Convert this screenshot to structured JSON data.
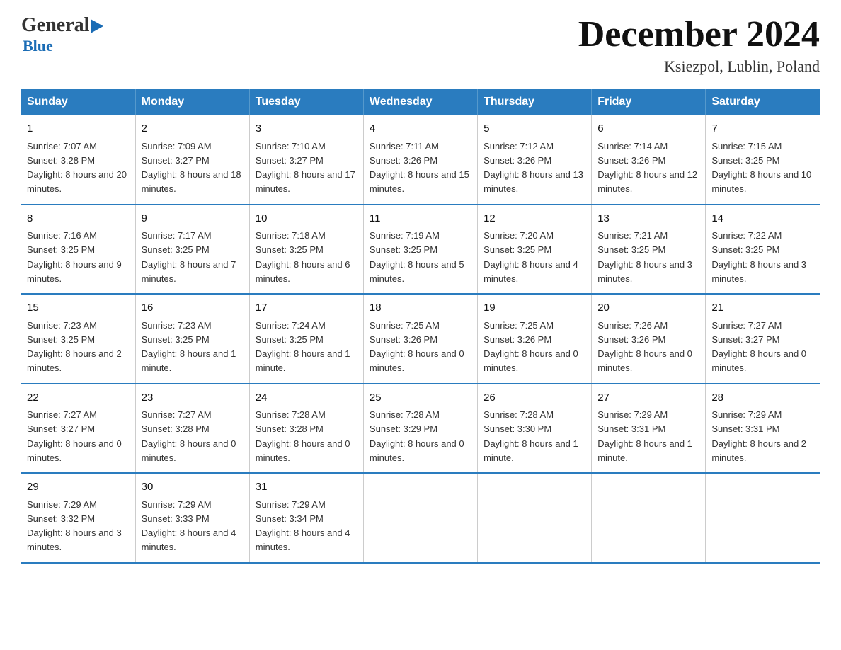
{
  "logo": {
    "general": "General",
    "blue": "Blue",
    "arrow_color": "#1a6cb5"
  },
  "header": {
    "title": "December 2024",
    "subtitle": "Ksiezpol, Lublin, Poland"
  },
  "weekdays": [
    "Sunday",
    "Monday",
    "Tuesday",
    "Wednesday",
    "Thursday",
    "Friday",
    "Saturday"
  ],
  "weeks": [
    [
      {
        "day": "1",
        "sunrise": "7:07 AM",
        "sunset": "3:28 PM",
        "daylight": "8 hours and 20 minutes."
      },
      {
        "day": "2",
        "sunrise": "7:09 AM",
        "sunset": "3:27 PM",
        "daylight": "8 hours and 18 minutes."
      },
      {
        "day": "3",
        "sunrise": "7:10 AM",
        "sunset": "3:27 PM",
        "daylight": "8 hours and 17 minutes."
      },
      {
        "day": "4",
        "sunrise": "7:11 AM",
        "sunset": "3:26 PM",
        "daylight": "8 hours and 15 minutes."
      },
      {
        "day": "5",
        "sunrise": "7:12 AM",
        "sunset": "3:26 PM",
        "daylight": "8 hours and 13 minutes."
      },
      {
        "day": "6",
        "sunrise": "7:14 AM",
        "sunset": "3:26 PM",
        "daylight": "8 hours and 12 minutes."
      },
      {
        "day": "7",
        "sunrise": "7:15 AM",
        "sunset": "3:25 PM",
        "daylight": "8 hours and 10 minutes."
      }
    ],
    [
      {
        "day": "8",
        "sunrise": "7:16 AM",
        "sunset": "3:25 PM",
        "daylight": "8 hours and 9 minutes."
      },
      {
        "day": "9",
        "sunrise": "7:17 AM",
        "sunset": "3:25 PM",
        "daylight": "8 hours and 7 minutes."
      },
      {
        "day": "10",
        "sunrise": "7:18 AM",
        "sunset": "3:25 PM",
        "daylight": "8 hours and 6 minutes."
      },
      {
        "day": "11",
        "sunrise": "7:19 AM",
        "sunset": "3:25 PM",
        "daylight": "8 hours and 5 minutes."
      },
      {
        "day": "12",
        "sunrise": "7:20 AM",
        "sunset": "3:25 PM",
        "daylight": "8 hours and 4 minutes."
      },
      {
        "day": "13",
        "sunrise": "7:21 AM",
        "sunset": "3:25 PM",
        "daylight": "8 hours and 3 minutes."
      },
      {
        "day": "14",
        "sunrise": "7:22 AM",
        "sunset": "3:25 PM",
        "daylight": "8 hours and 3 minutes."
      }
    ],
    [
      {
        "day": "15",
        "sunrise": "7:23 AM",
        "sunset": "3:25 PM",
        "daylight": "8 hours and 2 minutes."
      },
      {
        "day": "16",
        "sunrise": "7:23 AM",
        "sunset": "3:25 PM",
        "daylight": "8 hours and 1 minute."
      },
      {
        "day": "17",
        "sunrise": "7:24 AM",
        "sunset": "3:25 PM",
        "daylight": "8 hours and 1 minute."
      },
      {
        "day": "18",
        "sunrise": "7:25 AM",
        "sunset": "3:26 PM",
        "daylight": "8 hours and 0 minutes."
      },
      {
        "day": "19",
        "sunrise": "7:25 AM",
        "sunset": "3:26 PM",
        "daylight": "8 hours and 0 minutes."
      },
      {
        "day": "20",
        "sunrise": "7:26 AM",
        "sunset": "3:26 PM",
        "daylight": "8 hours and 0 minutes."
      },
      {
        "day": "21",
        "sunrise": "7:27 AM",
        "sunset": "3:27 PM",
        "daylight": "8 hours and 0 minutes."
      }
    ],
    [
      {
        "day": "22",
        "sunrise": "7:27 AM",
        "sunset": "3:27 PM",
        "daylight": "8 hours and 0 minutes."
      },
      {
        "day": "23",
        "sunrise": "7:27 AM",
        "sunset": "3:28 PM",
        "daylight": "8 hours and 0 minutes."
      },
      {
        "day": "24",
        "sunrise": "7:28 AM",
        "sunset": "3:28 PM",
        "daylight": "8 hours and 0 minutes."
      },
      {
        "day": "25",
        "sunrise": "7:28 AM",
        "sunset": "3:29 PM",
        "daylight": "8 hours and 0 minutes."
      },
      {
        "day": "26",
        "sunrise": "7:28 AM",
        "sunset": "3:30 PM",
        "daylight": "8 hours and 1 minute."
      },
      {
        "day": "27",
        "sunrise": "7:29 AM",
        "sunset": "3:31 PM",
        "daylight": "8 hours and 1 minute."
      },
      {
        "day": "28",
        "sunrise": "7:29 AM",
        "sunset": "3:31 PM",
        "daylight": "8 hours and 2 minutes."
      }
    ],
    [
      {
        "day": "29",
        "sunrise": "7:29 AM",
        "sunset": "3:32 PM",
        "daylight": "8 hours and 3 minutes."
      },
      {
        "day": "30",
        "sunrise": "7:29 AM",
        "sunset": "3:33 PM",
        "daylight": "8 hours and 4 minutes."
      },
      {
        "day": "31",
        "sunrise": "7:29 AM",
        "sunset": "3:34 PM",
        "daylight": "8 hours and 4 minutes."
      },
      null,
      null,
      null,
      null
    ]
  ]
}
